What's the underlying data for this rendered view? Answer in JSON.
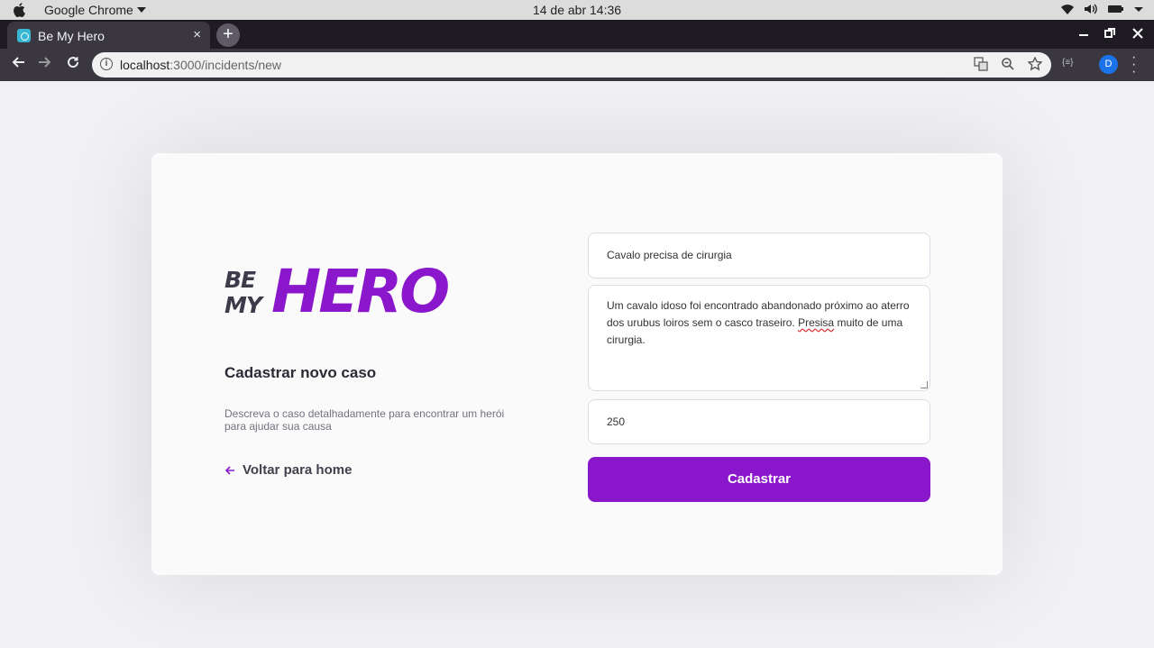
{
  "os": {
    "app_name": "Google Chrome",
    "clock": "14 de abr  14:36"
  },
  "browser": {
    "tab_title": "Be My Hero",
    "tab_close": "×",
    "new_tab": "+",
    "url_host": "localhost",
    "url_path": ":3000/incidents/new",
    "profile_initial": "D"
  },
  "page": {
    "logo": {
      "be": "BE",
      "my": "MY",
      "hero": "HERO"
    },
    "heading": "Cadastrar novo caso",
    "description": "Descreva o caso detalhadamente para encontrar um herói para ajudar sua causa",
    "back_link": "Voltar para home",
    "form": {
      "title_value": "Cavalo precisa de cirurgia",
      "description_before": "Um cavalo idoso foi encontrado abandonado próximo ao aterro dos urubus loiros  sem o casco traseiro. ",
      "description_misspelled": "Presisa",
      "description_after": " muito de uma cirurgia.",
      "value": "250",
      "submit_label": "Cadastrar"
    }
  },
  "colors": {
    "brand_purple": "#8b17cc",
    "background": "#f0f0f5"
  }
}
